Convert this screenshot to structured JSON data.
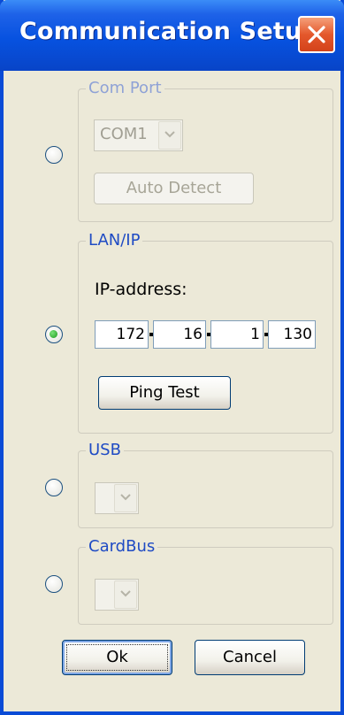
{
  "window": {
    "title": "Communication Setup"
  },
  "com_port": {
    "label": "Com Port",
    "port_value": "COM1",
    "auto_detect_label": "Auto Detect"
  },
  "lan_ip": {
    "label": "LAN/IP",
    "ip_label": "IP-address:",
    "octets": [
      "172",
      "16",
      "1",
      "130"
    ],
    "ping_label": "Ping Test"
  },
  "usb": {
    "label": "USB"
  },
  "cardbus": {
    "label": "CardBus"
  },
  "selected_connection": "LAN/IP",
  "buttons": {
    "ok": "Ok",
    "cancel": "Cancel"
  },
  "colors": {
    "title_bar": "#0752e0",
    "window_bg": "#ece9d8",
    "group_label": "#1f4bc4"
  }
}
